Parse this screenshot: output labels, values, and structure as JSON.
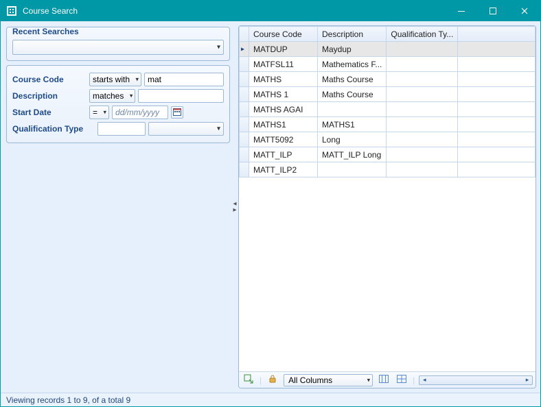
{
  "window": {
    "title": "Course Search"
  },
  "recent": {
    "heading": "Recent Searches",
    "value": ""
  },
  "filters": {
    "course_code": {
      "label": "Course Code",
      "op": "starts with",
      "value": "mat"
    },
    "description": {
      "label": "Description",
      "op": "matches",
      "value": ""
    },
    "start_date": {
      "label": "Start Date",
      "op": "=",
      "placeholder": "dd/mm/yyyy"
    },
    "qual_type": {
      "label": "Qualification Type",
      "value": "",
      "combo_value": ""
    }
  },
  "grid": {
    "columns": [
      "Course Code",
      "Description",
      "Qualification Ty...",
      ""
    ],
    "rows": [
      {
        "code": "MATDUP",
        "desc": "Maydup",
        "qual": "",
        "c4": "",
        "selected": true
      },
      {
        "code": "MATFSL11",
        "desc": "Mathematics F...",
        "qual": "",
        "c4": ""
      },
      {
        "code": "MATHS",
        "desc": "Maths Course",
        "qual": "",
        "c4": ""
      },
      {
        "code": "MATHS 1",
        "desc": "Maths Course",
        "qual": "",
        "c4": ""
      },
      {
        "code": "MATHS AGAI",
        "desc": "",
        "qual": "",
        "c4": ""
      },
      {
        "code": "MATHS1",
        "desc": "MATHS1",
        "qual": "",
        "c4": ""
      },
      {
        "code": "MATT5092",
        "desc": "Long",
        "qual": "",
        "c4": ""
      },
      {
        "code": "MATT_ILP",
        "desc": "MATT_ILP Long",
        "qual": "",
        "c4": ""
      },
      {
        "code": "MATT_ILP2",
        "desc": "",
        "qual": "",
        "c4": ""
      }
    ]
  },
  "toolbar": {
    "columns_selector": "All Columns"
  },
  "status": {
    "text": "Viewing records 1 to 9, of a total 9"
  }
}
